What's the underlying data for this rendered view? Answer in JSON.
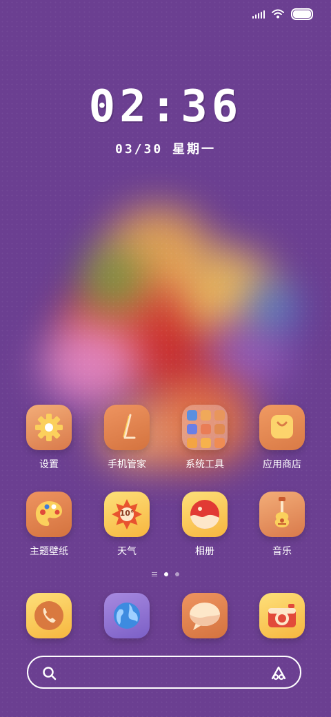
{
  "status_bar": {
    "signal_icon": "cellular-signal-icon",
    "wifi_icon": "wifi-icon",
    "battery_icon": "battery-icon"
  },
  "lockclock": {
    "time": "02:36",
    "date": "03/30 星期一"
  },
  "apps_row1": [
    {
      "label": "设置",
      "icon": "gear-icon"
    },
    {
      "label": "手机管家",
      "icon": "phone-manager-icon"
    },
    {
      "label": "系统工具",
      "icon": "folder-icon"
    },
    {
      "label": "应用商店",
      "icon": "shopping-bag-icon"
    }
  ],
  "apps_row2": [
    {
      "label": "主题壁纸",
      "icon": "palette-icon"
    },
    {
      "label": "天气",
      "icon": "weather-sun-icon",
      "temp": "10°"
    },
    {
      "label": "相册",
      "icon": "gallery-icon"
    },
    {
      "label": "音乐",
      "icon": "guitar-icon"
    }
  ],
  "page_indicator": {
    "pages": 2,
    "current": 1
  },
  "dock": [
    {
      "icon": "phone-icon"
    },
    {
      "icon": "browser-globe-icon"
    },
    {
      "icon": "messages-icon"
    },
    {
      "icon": "camera-icon"
    }
  ],
  "search": {
    "placeholder": "",
    "assistant_icon": "assistant-icon"
  },
  "colors": {
    "background": "#6b3f91",
    "icon_orange": "#e6915a",
    "icon_yellow": "#fbd05c"
  }
}
